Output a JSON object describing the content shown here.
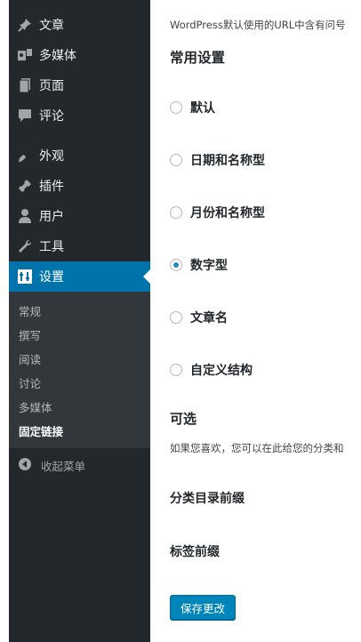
{
  "sidebar": {
    "items": [
      {
        "label": "文章",
        "icon": "pin-icon"
      },
      {
        "label": "多媒体",
        "icon": "media-icon"
      },
      {
        "label": "页面",
        "icon": "page-icon"
      },
      {
        "label": "评论",
        "icon": "comment-icon"
      },
      {
        "label": "外观",
        "icon": "brush-icon"
      },
      {
        "label": "插件",
        "icon": "plugin-icon"
      },
      {
        "label": "用户",
        "icon": "user-icon"
      },
      {
        "label": "工具",
        "icon": "wrench-icon"
      },
      {
        "label": "设置",
        "icon": "settings-icon",
        "active": true
      }
    ],
    "submenu": [
      "常规",
      "撰写",
      "阅读",
      "讨论",
      "多媒体",
      "固定链接"
    ],
    "submenu_current": "固定链接",
    "collapse_label": "收起菜单"
  },
  "content": {
    "intro": "WordPress默认使用的URL中含有问号",
    "common_heading": "常用设置",
    "options": [
      {
        "label": "默认",
        "selected": false
      },
      {
        "label": "日期和名称型",
        "selected": false
      },
      {
        "label": "月份和名称型",
        "selected": false
      },
      {
        "label": "数字型",
        "selected": true
      },
      {
        "label": "文章名",
        "selected": false
      },
      {
        "label": "自定义结构",
        "selected": false
      }
    ],
    "optional_heading": "可选",
    "optional_desc": "如果您喜欢，您可以在此给您的分类和",
    "category_base_label": "分类目录前缀",
    "tag_base_label": "标签前缀",
    "save_button": "保存更改"
  },
  "colors": {
    "sidebar_bg": "#23282d",
    "submenu_bg": "#32373c",
    "active_bg": "#0073aa",
    "button_bg": "#0085ba"
  }
}
